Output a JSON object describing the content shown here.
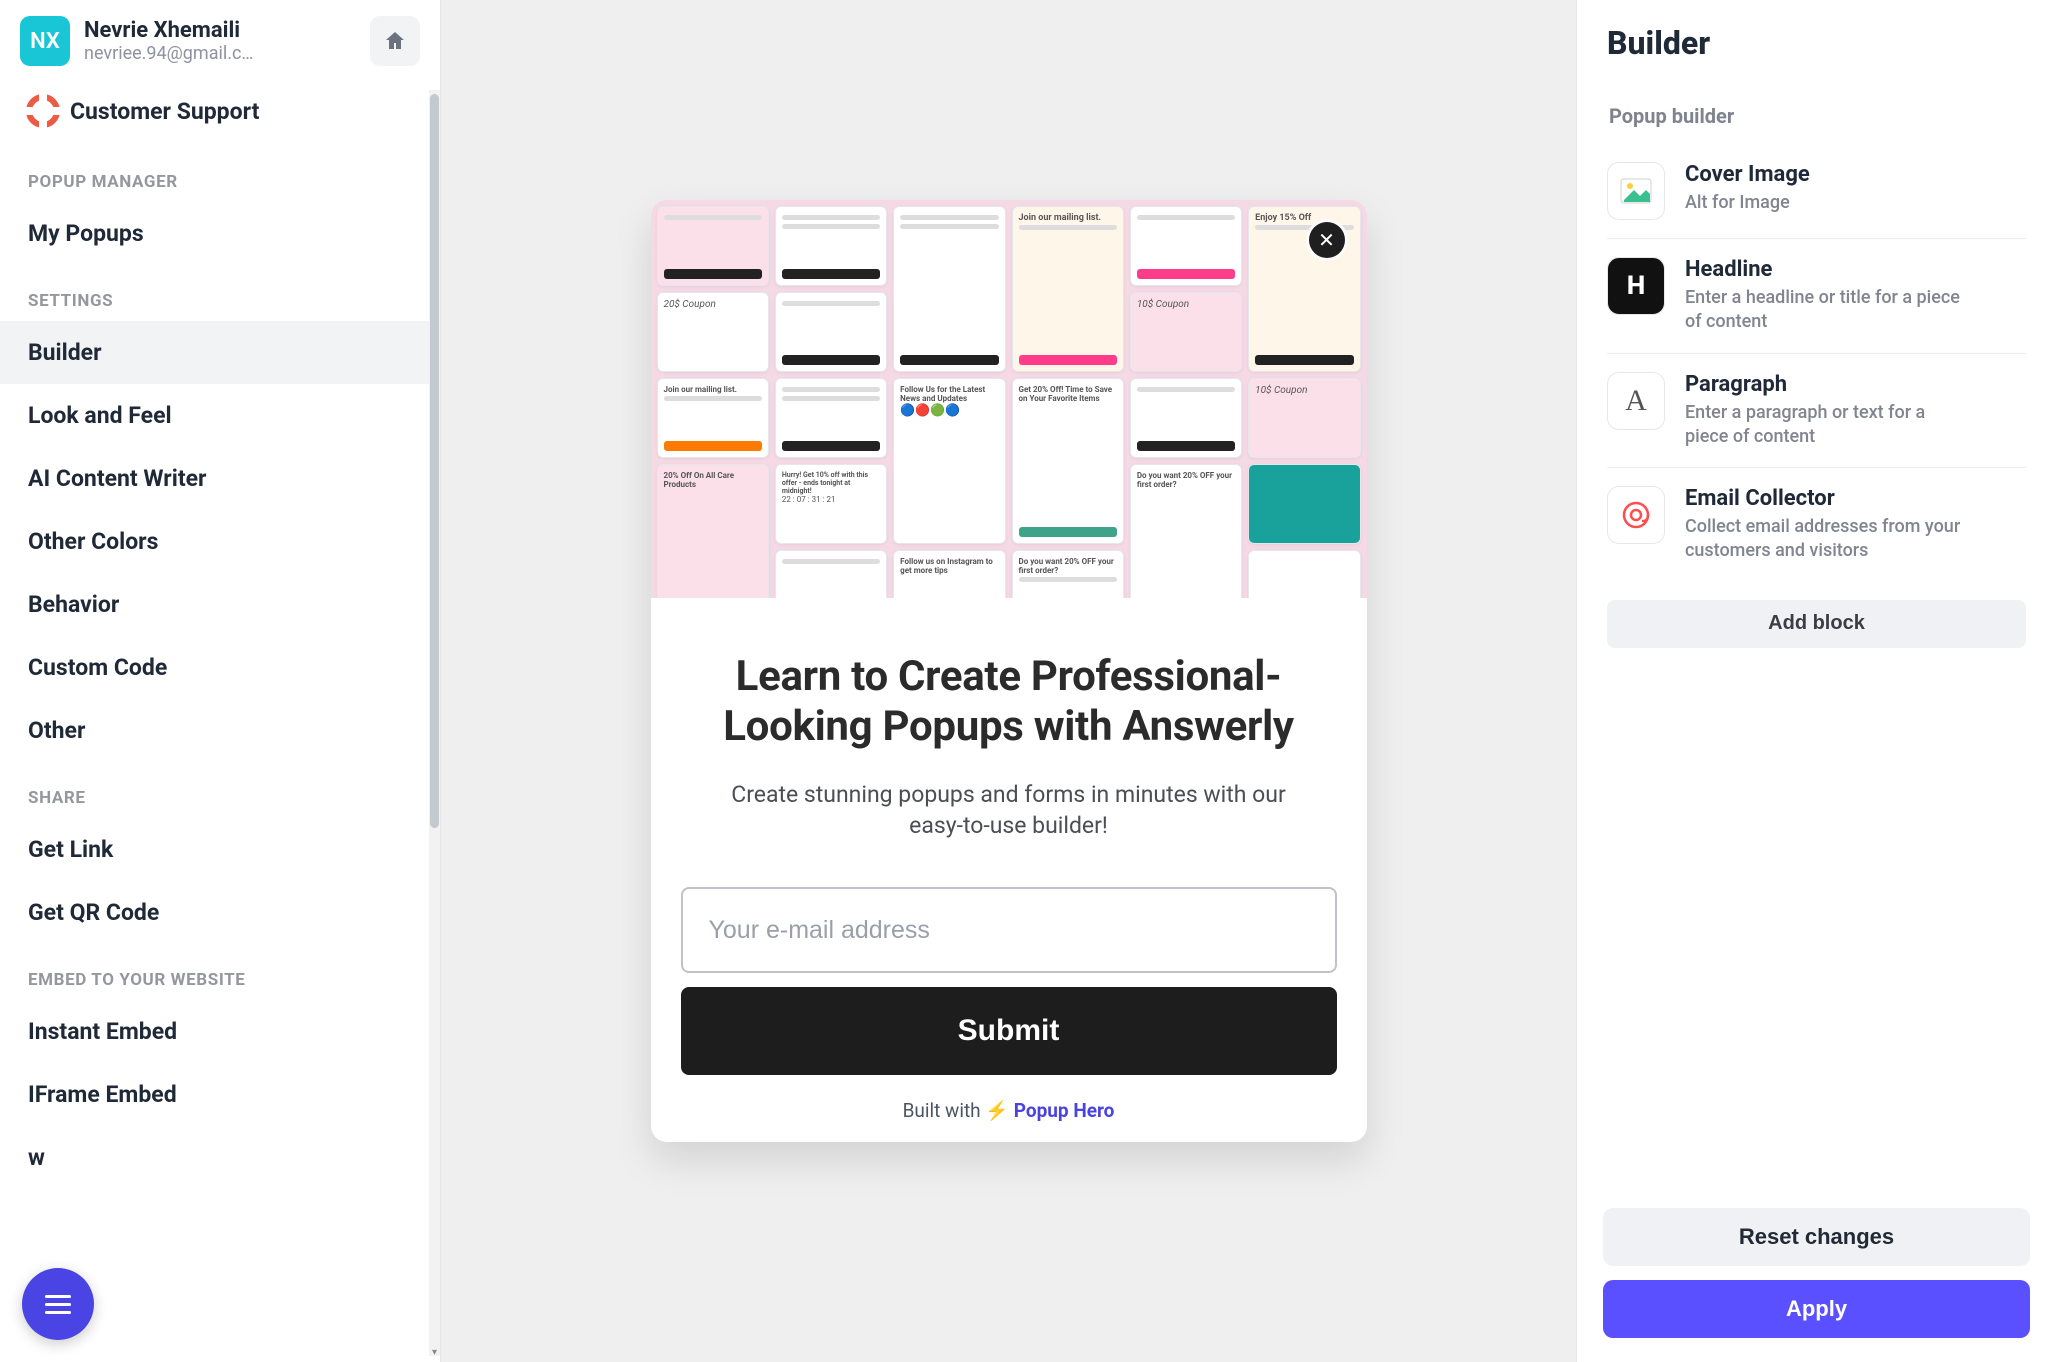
{
  "user": {
    "initials": "NX",
    "name": "Nevrie Xhemaili",
    "email": "nevriee.94@gmail.c…"
  },
  "sidebar": {
    "support_label": "Customer Support",
    "sections": {
      "popup_manager": {
        "label": "POPUP MANAGER",
        "items": [
          "My Popups"
        ]
      },
      "settings": {
        "label": "SETTINGS",
        "items": [
          "Builder",
          "Look and Feel",
          "AI Content Writer",
          "Other Colors",
          "Behavior",
          "Custom Code",
          "Other"
        ]
      },
      "share": {
        "label": "SHARE",
        "items": [
          "Get Link",
          "Get QR Code"
        ]
      },
      "embed": {
        "label": "EMBED TO YOUR WEBSITE",
        "items": [
          "Instant Embed",
          "IFrame Embed",
          "w"
        ]
      }
    },
    "active_item": "Builder"
  },
  "popup": {
    "headline": "Learn to Create Professional-Looking Popups with Answerly",
    "paragraph": "Create stunning popups and forms in minutes with our easy-to-use builder!",
    "email_placeholder": "Your e-mail address",
    "submit_label": "Submit",
    "footer_prefix": "Built with ",
    "footer_emoji": "⚡",
    "footer_brand": "Popup Hero"
  },
  "panel": {
    "title": "Builder",
    "subtitle": "Popup builder",
    "blocks": [
      {
        "title": "Cover Image",
        "desc": "Alt for Image"
      },
      {
        "title": "Headline",
        "desc": "Enter a headline or title for a piece of content"
      },
      {
        "title": "Paragraph",
        "desc": "Enter a paragraph or text for a piece of content"
      },
      {
        "title": "Email Collector",
        "desc": "Collect email addresses from your customers and visitors"
      }
    ],
    "add_block_label": "Add block",
    "reset_label": "Reset changes",
    "apply_label": "Apply"
  },
  "icons": {
    "home": "home-icon",
    "support": "lifering-icon",
    "cover_image": "image-icon",
    "headline": "H",
    "paragraph": "A",
    "email": "at-icon"
  },
  "colors": {
    "accent": "#5a50ff",
    "avatar_bg": "#18c6d6"
  }
}
